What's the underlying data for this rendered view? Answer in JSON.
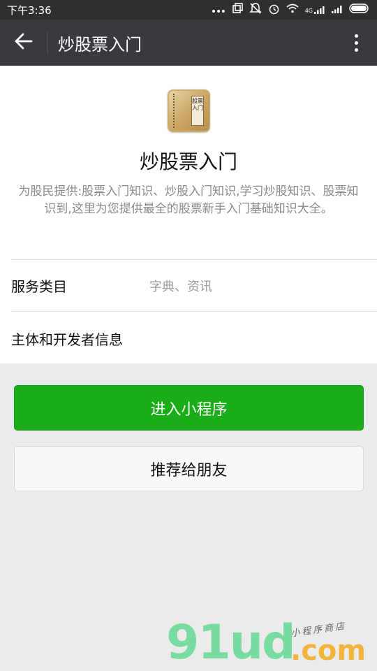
{
  "status_bar": {
    "time": "下午3:36",
    "icons": [
      "more-dots-icon",
      "screen-cast-icon",
      "mute-icon",
      "alarm-icon",
      "wifi-icon",
      "4g-signal-icon",
      "signal-icon",
      "battery-icon"
    ],
    "network_label": "4G"
  },
  "toolbar": {
    "title": "炒股票入门"
  },
  "app": {
    "icon_text": "股票入门",
    "name": "炒股票入门",
    "description": "为股民提供:股票入门知识、炒股入门知识,学习炒股知识、股票知识到,这里为您提供最全的股票新手入门基础知识大全。"
  },
  "rows": {
    "service_category": {
      "label": "服务类目",
      "value": "字典、资讯"
    },
    "developer_info": {
      "label": "主体和开发者信息"
    }
  },
  "buttons": {
    "enter": "进入小程序",
    "recommend": "推荐给朋友"
  },
  "watermark": {
    "main": "91ud",
    "domain": ".com",
    "sub": "小程序商店"
  },
  "colors": {
    "primary_green": "#1aad19",
    "toolbar_bg": "#393a3e",
    "status_bg": "#2f2f2f",
    "page_bg": "#ebebeb"
  }
}
